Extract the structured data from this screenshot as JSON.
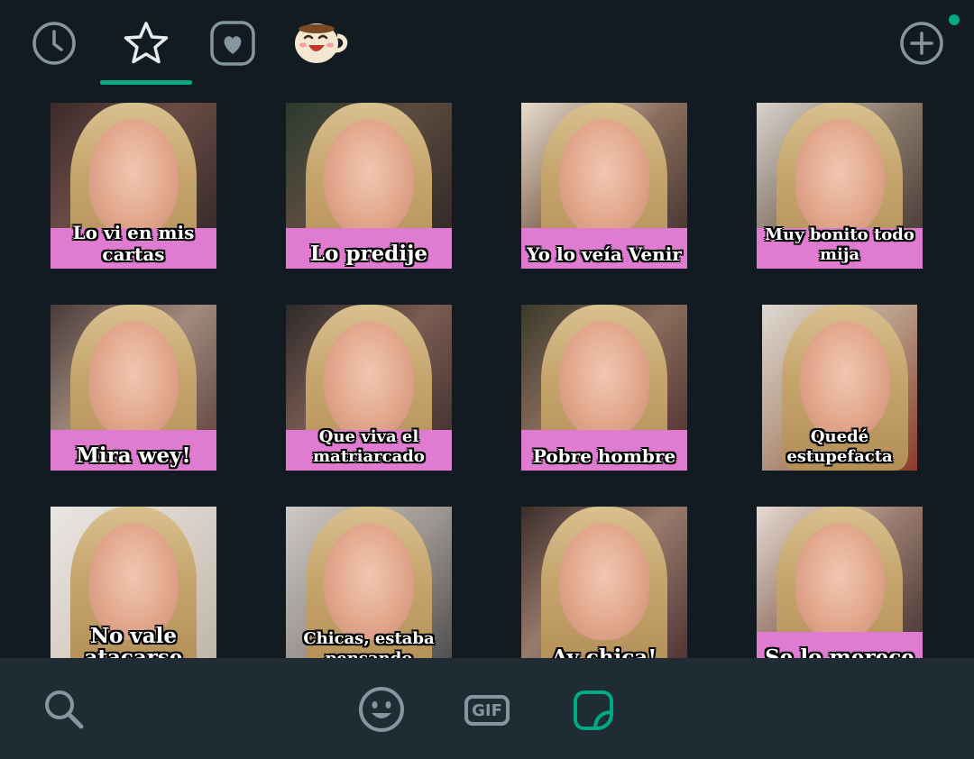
{
  "topbar": {
    "tabs": [
      {
        "name": "recent",
        "icon": "clock-icon"
      },
      {
        "name": "favorites",
        "icon": "star-icon",
        "active": true
      },
      {
        "name": "liked",
        "icon": "heart-icon"
      },
      {
        "name": "pack",
        "icon": "coffee-cup-sticker-icon"
      }
    ],
    "add_icon": "plus-circle-icon",
    "accent_color": "#00a884"
  },
  "stickers": [
    {
      "caption": "Lo vi en mis cartas"
    },
    {
      "caption": "Lo predije"
    },
    {
      "caption": "Yo lo veía Venir"
    },
    {
      "caption": "Muy bonito todo mija"
    },
    {
      "caption": "Mira wey!"
    },
    {
      "caption": "Que viva el matriarcado"
    },
    {
      "caption": "Pobre hombre"
    },
    {
      "caption": "Quedé estupefacta"
    },
    {
      "caption": "No vale atacarse"
    },
    {
      "caption": "Chicas, estaba pensando"
    },
    {
      "caption": "Ay chica!"
    },
    {
      "caption": "Se lo merece"
    }
  ],
  "bottombar": {
    "search_icon": "search-icon",
    "emoji_icon": "emoji-icon",
    "gif_label": "GIF",
    "sticker_icon": "sticker-icon",
    "active": "sticker"
  }
}
